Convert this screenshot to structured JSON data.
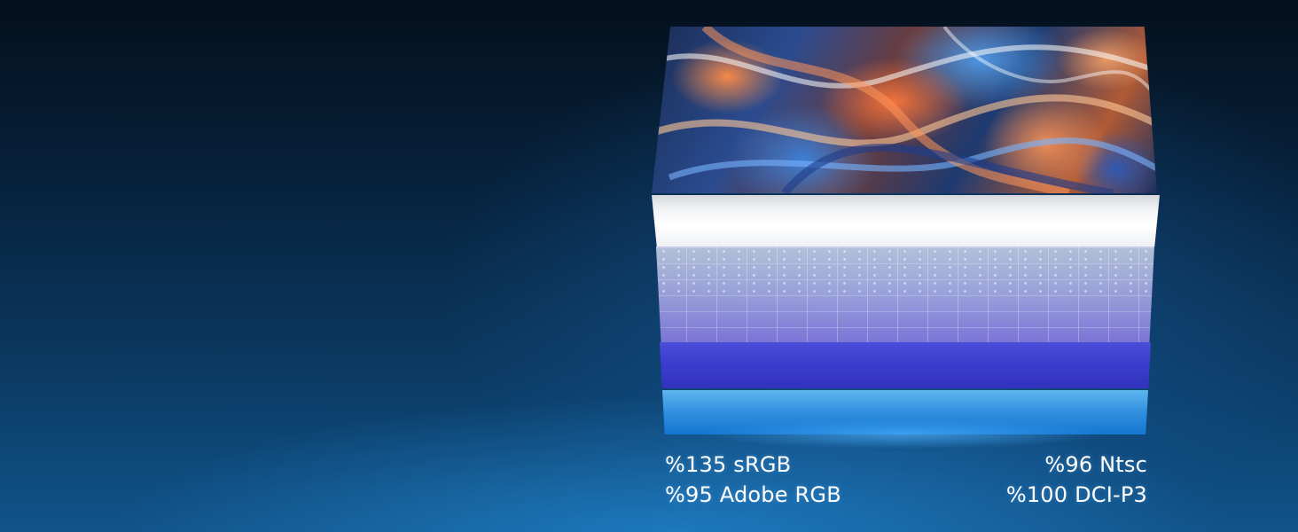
{
  "specs": {
    "left": [
      "%135 sRGB",
      "%95 Adobe RGB"
    ],
    "right": [
      "%96 Ntsc",
      "%100 DCI-P3"
    ]
  },
  "colors": {
    "background_top": "#04101d",
    "background_bottom": "#11548a",
    "diffuser": "#ffffff",
    "violet_layer": "#3a3ccd",
    "blue_layer": "#2f8fdf",
    "artwork_orange": "#ff8c46",
    "artwork_blue": "#3c82dc"
  }
}
